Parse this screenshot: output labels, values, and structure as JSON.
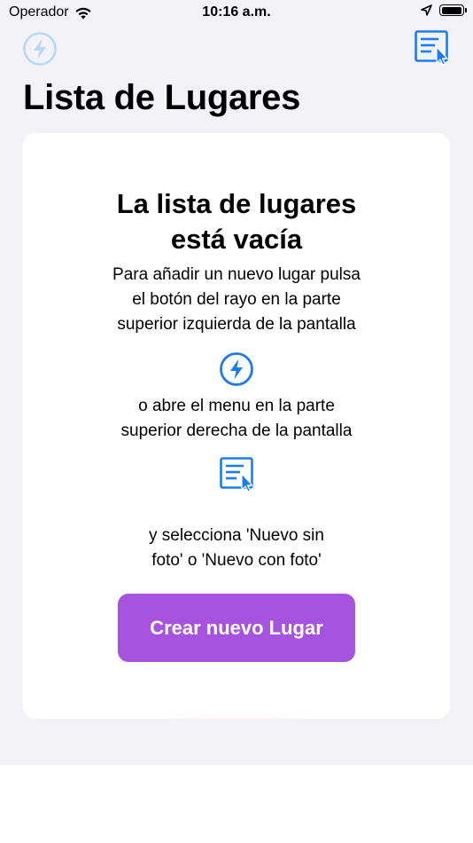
{
  "status_bar": {
    "carrier": "Operador",
    "time": "10:16 a.m."
  },
  "nav": {
    "left_icon": "bolt-circle-icon",
    "right_icon": "menu-list-cursor-icon"
  },
  "page": {
    "title": "Lista de Lugares"
  },
  "empty_state": {
    "title_line1": "La lista de lugares",
    "title_line2": "está vacía",
    "instruction1_line1": "Para añadir un nuevo lugar pulsa",
    "instruction1_line2": "el botón del rayo en la parte",
    "instruction1_line3": "superior izquierda de la pantalla",
    "instruction2_line1": "o abre el menu en la parte",
    "instruction2_line2": "superior derecha de la pantalla",
    "instruction3_line1": "y selecciona 'Nuevo sin",
    "instruction3_line2": "foto' o 'Nuevo con foto'",
    "bolt_icon": "bolt-circle-icon",
    "menu_icon": "menu-list-cursor-icon",
    "button_label": "Crear nuevo Lugar"
  },
  "colors": {
    "accent_blue": "#1a7cf0",
    "disabled_blue": "#b9d7f7",
    "button_purple": "#a653e0",
    "background": "#f2f2f7",
    "glow": "#ff8a9a"
  }
}
